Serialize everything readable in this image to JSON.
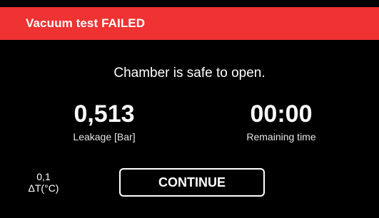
{
  "header": {
    "title": "Vacuum test FAILED",
    "color": "#ef3232"
  },
  "message": "Chamber is safe to open.",
  "stats": {
    "leakage": {
      "value": "0,513",
      "label": "Leakage [Bar]"
    },
    "remaining_time": {
      "value": "00:00",
      "label": "Remaining time"
    }
  },
  "delta_t": {
    "value": "0,1",
    "label": "ΔT(°C)"
  },
  "actions": {
    "continue_label": "CONTINUE"
  }
}
